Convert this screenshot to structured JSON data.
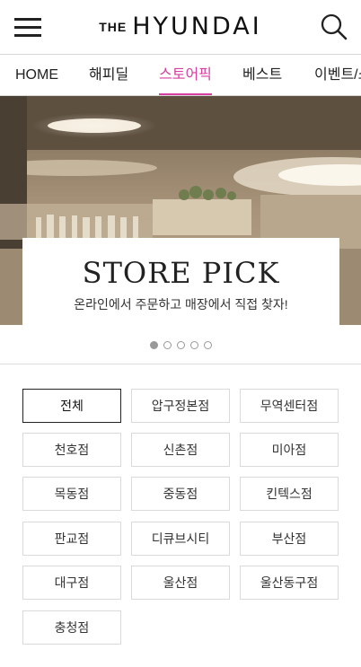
{
  "header": {
    "logo_small": "THE",
    "logo_main": "HYUNDAI"
  },
  "nav": {
    "items": [
      {
        "label": "HOME"
      },
      {
        "label": "해피딜"
      },
      {
        "label": "스토어픽"
      },
      {
        "label": "베스트"
      },
      {
        "label": "이벤트/쇼"
      }
    ],
    "active_index": 2,
    "active_color": "#d63fa0"
  },
  "banner": {
    "title": "STORE PICK",
    "subtitle": "온라인에서 주문하고 매장에서 직접 찾자!",
    "slide_count": 5,
    "active_slide": 0
  },
  "stores": {
    "selected_index": 0,
    "items": [
      {
        "label": "전체"
      },
      {
        "label": "압구정본점"
      },
      {
        "label": "무역센터점"
      },
      {
        "label": "천호점"
      },
      {
        "label": "신촌점"
      },
      {
        "label": "미아점"
      },
      {
        "label": "목동점"
      },
      {
        "label": "중동점"
      },
      {
        "label": "킨텍스점"
      },
      {
        "label": "판교점"
      },
      {
        "label": "디큐브시티"
      },
      {
        "label": "부산점"
      },
      {
        "label": "대구점"
      },
      {
        "label": "울산점"
      },
      {
        "label": "울산동구점"
      },
      {
        "label": "충청점"
      }
    ]
  }
}
